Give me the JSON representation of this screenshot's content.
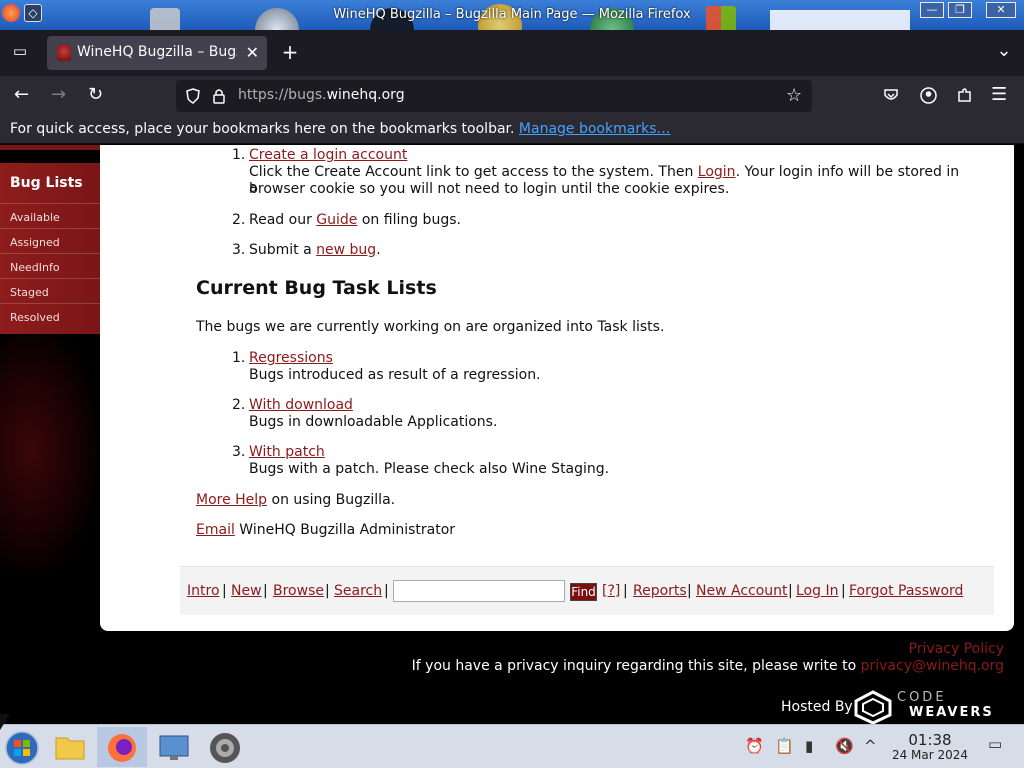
{
  "window": {
    "title": "WineHQ Bugzilla – Bugzilla Main Page — Mozilla Firefox",
    "controls": {
      "minimize": "—",
      "maximize": "❐",
      "close": "✕"
    }
  },
  "tabs": [
    {
      "label": "WineHQ Bugzilla – Bugzil",
      "close": "✕"
    }
  ],
  "toolbar": {
    "new_tab": "+",
    "list_tabs": "⌄",
    "back": "←",
    "forward": "→",
    "reload": "↻",
    "star": "☆",
    "menu": "☰"
  },
  "url": {
    "prefix": "https://bugs.",
    "domain": "winehq.org"
  },
  "bookmarks_bar": {
    "text": "For quick access, place your bookmarks here on the bookmarks toolbar.",
    "link": "Manage bookmarks…"
  },
  "sidebar": {
    "heading": "Bug Lists",
    "items": [
      "Available",
      "Assigned",
      "NeedInfo",
      "Staged",
      "Resolved"
    ]
  },
  "steps": {
    "item1_num": "1.",
    "item1_link": "Create a login account",
    "item1_text_a": "Click the Create Account link to get access to the system. Then",
    "item1_login": "Login",
    "item1_text_b": ". Your login info will be stored in a",
    "item1_text_c": "browser cookie so you will not need to login until the cookie expires.",
    "item2_num": "2.",
    "item2_a": "Read our",
    "item2_link": "Guide",
    "item2_b": "on filing bugs.",
    "item3_num": "3.",
    "item3_a": "Submit a",
    "item3_link": "new bug",
    "item3_b": "."
  },
  "task_lists": {
    "heading": "Current Bug Task Lists",
    "intro": "The bugs we are currently working on are organized into Task lists.",
    "items": [
      {
        "num": "1.",
        "link": "Regressions",
        "desc": "Bugs introduced as result of a regression."
      },
      {
        "num": "2.",
        "link": "With download",
        "desc": "Bugs in downloadable Applications."
      },
      {
        "num": "3.",
        "link": "With patch",
        "desc": "Bugs with a patch. Please check also Wine Staging."
      }
    ]
  },
  "help": {
    "link": "More Help",
    "text": "on using Bugzilla."
  },
  "admin": {
    "link": "Email",
    "text": "WineHQ Bugzilla Administrator"
  },
  "quicknav": {
    "intro": "Intro",
    "new": "New",
    "browse": "Browse",
    "search": "Search",
    "find": "Find",
    "help": "[?]",
    "reports": "Reports",
    "new_account": "New Account",
    "login": "Log In",
    "forgot": "Forgot Password",
    "sep": "|",
    "search_value": ""
  },
  "footer": {
    "privacy_policy": "Privacy Policy",
    "inquiry_text": "If you have a privacy inquiry regarding this site, please write to",
    "inquiry_email": "privacy@winehq.org",
    "hosted_by": "Hosted By",
    "logo_code": "CODE",
    "logo_weavers": "WEAVERS"
  },
  "taskbar": {
    "time": "01:38",
    "date": "24 Mar 2024"
  }
}
